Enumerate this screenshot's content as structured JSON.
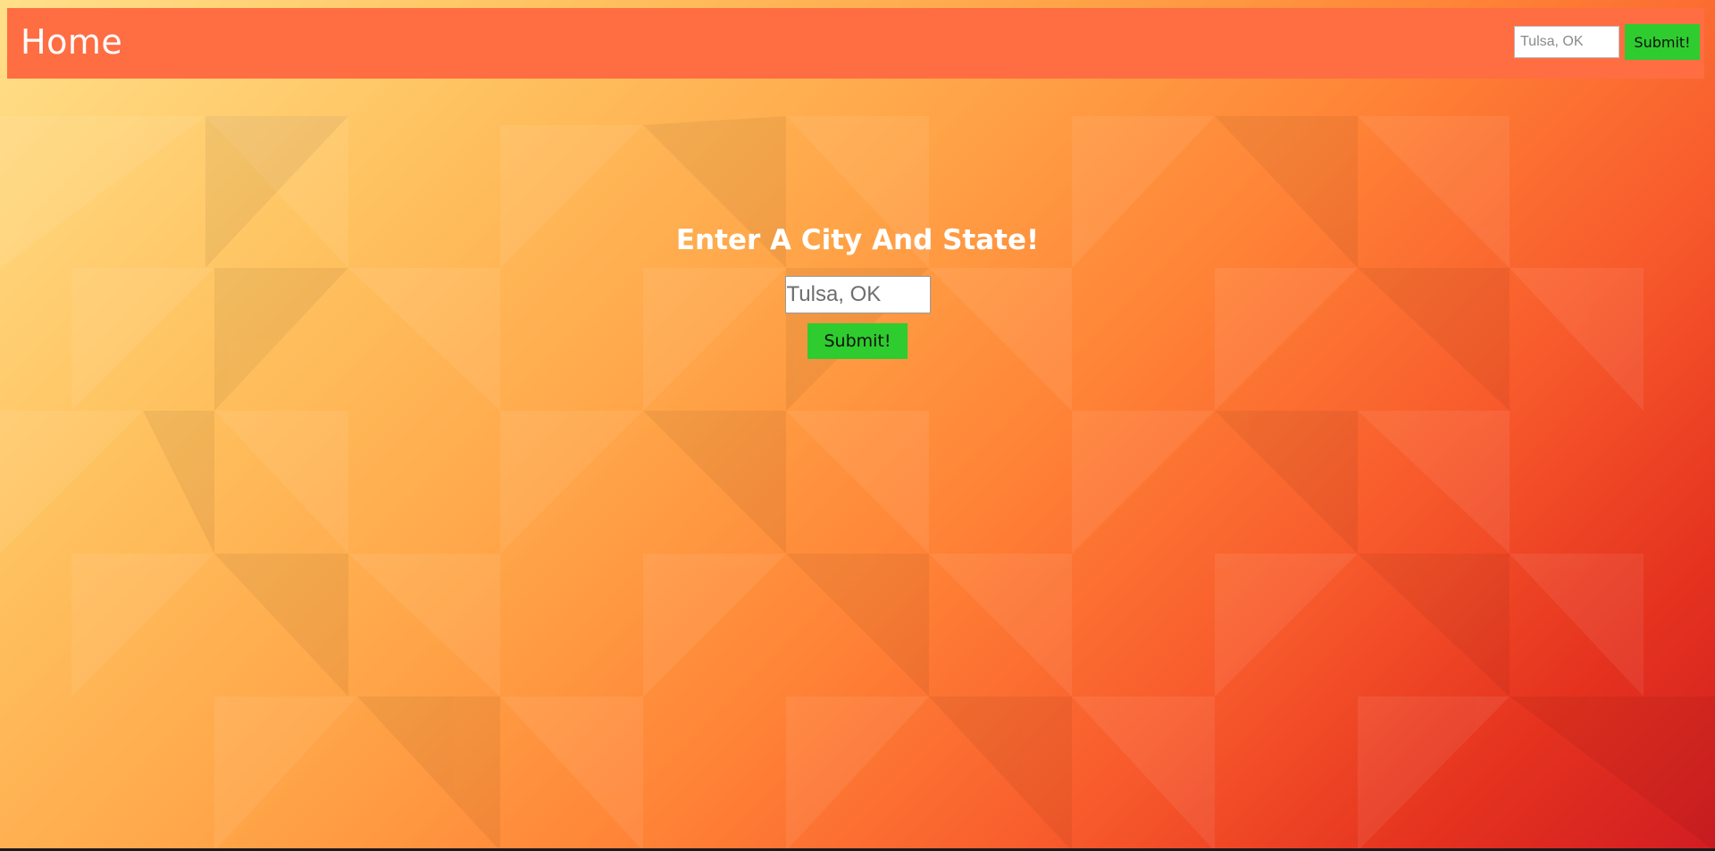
{
  "navbar": {
    "brand": "Home",
    "search": {
      "placeholder": "Tulsa, OK",
      "value": ""
    },
    "submit_label": "Submit!"
  },
  "hero": {
    "title": "Enter A City And State!",
    "search": {
      "placeholder": "Tulsa, OK",
      "value": ""
    },
    "submit_label": "Submit!"
  },
  "colors": {
    "navbar": "#ff6d43",
    "button": "#2ecc2e",
    "background_light": "#ffe08a",
    "background_dark": "#d11d22"
  }
}
